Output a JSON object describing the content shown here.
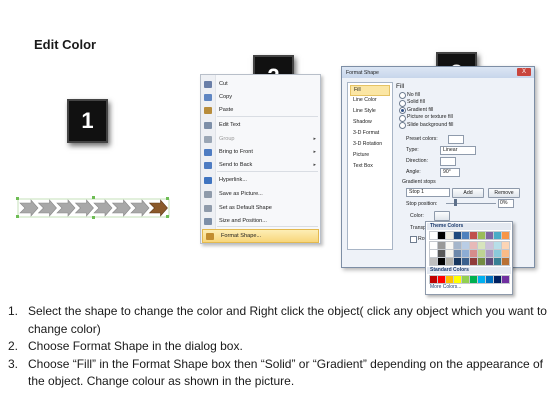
{
  "title": "Edit Color",
  "badges": [
    "1",
    "2",
    "3"
  ],
  "context_menu": {
    "items": [
      {
        "label": "Cut",
        "icon": "scissors-icon"
      },
      {
        "label": "Copy",
        "icon": "copy-icon"
      },
      {
        "label": "Paste",
        "icon": "paste-icon"
      },
      {
        "label": "Edit Text",
        "icon": "edit-text-icon"
      },
      {
        "label": "Group",
        "icon": "group-icon",
        "disabled": true,
        "submenu": true
      },
      {
        "label": "Bring to Front",
        "icon": "bring-to-front-icon",
        "submenu": true
      },
      {
        "label": "Send to Back",
        "icon": "send-to-back-icon",
        "submenu": true
      },
      {
        "label": "Hyperlink...",
        "icon": "hyperlink-icon"
      },
      {
        "label": "Save as Picture...",
        "icon": "save-picture-icon"
      },
      {
        "label": "Set as Default Shape",
        "icon": "default-shape-icon"
      },
      {
        "label": "Size and Position...",
        "icon": "size-position-icon"
      },
      {
        "label": "Format Shape...",
        "icon": "format-shape-icon",
        "highlighted": true
      }
    ]
  },
  "dialog": {
    "title": "Format Shape",
    "close": "X",
    "categories": [
      "Fill",
      "Line Color",
      "Line Style",
      "Shadow",
      "3-D Format",
      "3-D Rotation",
      "Picture",
      "Text Box"
    ],
    "pane_heading": "Fill",
    "fill_options": [
      "No fill",
      "Solid fill",
      "Gradient fill",
      "Picture or texture fill",
      "Slide background fill"
    ],
    "selected_fill": "Gradient fill",
    "preset_colors_label": "Preset colors:",
    "type_label": "Type:",
    "type_value": "Linear",
    "direction_label": "Direction:",
    "angle_label": "Angle:",
    "angle_value": "90°",
    "gradient_stops_label": "Gradient stops",
    "stop_value": "Stop 1",
    "add_button": "Add",
    "remove_button": "Remove",
    "stop_position_label": "Stop position:",
    "stop_position_value": "0%",
    "color_label": "Color:",
    "transparency_label": "Transpa",
    "rotate_label": "Rotate"
  },
  "palette": {
    "theme_colors_label": "Theme Colors",
    "standard_colors_label": "Standard Colors",
    "more_colors": "More Colors...",
    "theme_row": [
      "#ffffff",
      "#000000",
      "#eeece1",
      "#1f497d",
      "#4f81bd",
      "#c0504d",
      "#9bbb59",
      "#8064a2",
      "#4bacc6",
      "#f79646"
    ],
    "standard_row": [
      "#c00000",
      "#ff0000",
      "#ffc000",
      "#ffff00",
      "#92d050",
      "#00b050",
      "#00b0f0",
      "#0070c0",
      "#002060",
      "#7030a0"
    ]
  },
  "steps": [
    "Select the shape to change the color and Right click the object( click any object which you want to change color)",
    "Choose Format Shape in the dialog box.",
    "Choose “Fill” in the Format Shape box then “Solid” or “Gradient” depending on the appearance of the object. Change colour as shown in the picture."
  ],
  "colors": {
    "arrow_grey": "#a8a8a8",
    "arrow_selected": "#8b5a2b",
    "selection_handle": "#6ebd55",
    "menu_highlight": "#f8d67b"
  }
}
